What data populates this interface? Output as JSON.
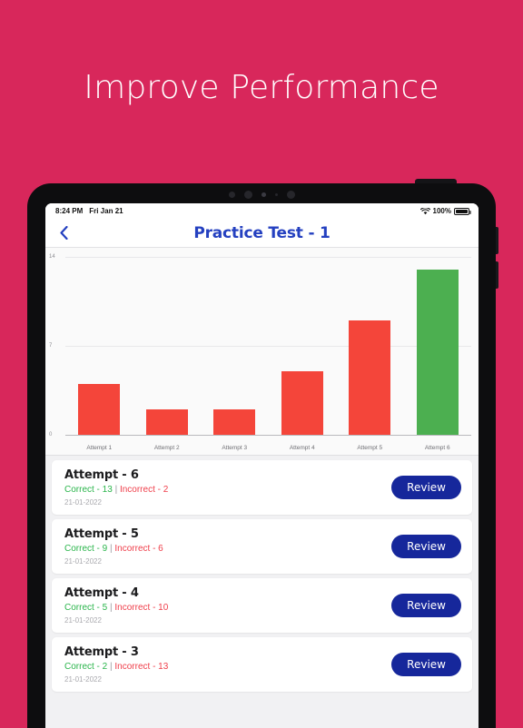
{
  "promo": {
    "headline": "Improve Performance",
    "background_color": "#d8275b"
  },
  "device": {
    "sensors": [
      "camera-dot",
      "camera-dot",
      "sensor-dot",
      "sensor-dot",
      "camera-dot"
    ],
    "buttons": [
      "power-button",
      "volume-up-button",
      "volume-down-button"
    ]
  },
  "status_bar": {
    "time": "8:24 PM",
    "date": "Fri Jan 21",
    "wifi_icon": "wifi-icon",
    "battery_percent": "100%",
    "battery_icon": "battery-icon"
  },
  "nav": {
    "back_icon": "chevron-left-icon",
    "title": "Practice Test - 1",
    "title_color": "#2440c0"
  },
  "chart_data": {
    "type": "bar",
    "title": "",
    "xlabel": "",
    "ylabel": "",
    "categories": [
      "Attempt 1",
      "Attempt 2",
      "Attempt 3",
      "Attempt 4",
      "Attempt 5",
      "Attempt 6"
    ],
    "values": [
      4,
      2,
      2,
      5,
      9,
      13
    ],
    "colors": [
      "#f4453a",
      "#f4453a",
      "#f4453a",
      "#f4453a",
      "#f4453a",
      "#4caf50"
    ],
    "ylim": [
      0,
      14
    ],
    "yticks": [
      0,
      7,
      14
    ],
    "ytick_labels": [
      "0",
      "7",
      "14"
    ],
    "grid": true,
    "legend": "none",
    "background": "#fafafa"
  },
  "attempts": {
    "review_label": "Review",
    "separator": "|",
    "items": [
      {
        "title": "Attempt - 6",
        "correct": "Correct - 13",
        "incorrect": "Incorrect - 2",
        "date": "21-01-2022"
      },
      {
        "title": "Attempt - 5",
        "correct": "Correct - 9",
        "incorrect": "Incorrect - 6",
        "date": "21-01-2022"
      },
      {
        "title": "Attempt - 4",
        "correct": "Correct - 5",
        "incorrect": "Incorrect - 10",
        "date": "21-01-2022"
      },
      {
        "title": "Attempt - 3",
        "correct": "Correct - 2",
        "incorrect": "Incorrect - 13",
        "date": "21-01-2022"
      }
    ]
  }
}
